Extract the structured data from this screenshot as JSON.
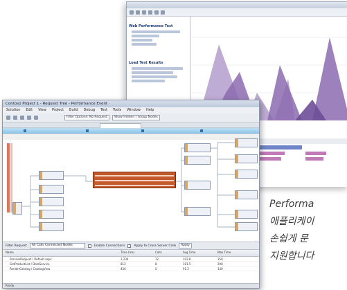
{
  "back_window": {
    "side_group_1": "Web Performance Test",
    "side_group_2": "Load Test Results"
  },
  "front_window": {
    "title": "Contoso Project 1 - Request Tree - Performance Event",
    "menu": [
      "Solution",
      "Edit",
      "View",
      "Project",
      "Build",
      "Debug",
      "Test",
      "Tools",
      "Window",
      "Help"
    ],
    "toolbar_dropdown": "Filter Options: No Request",
    "toolbar_button": "Show Hidden / Group Nodes",
    "filter_label": "Filter Request",
    "filter_value": "All Calls Connected Nodes",
    "filter_option_1": "Enable Connections",
    "filter_option_2": "Apply to Cross Server Calls",
    "filter_button": "Apply",
    "grid_headers": [
      "Name",
      "Time (ms)",
      "Calls",
      "Avg Time",
      "Max Time"
    ],
    "grid_rows": [
      [
        "ProcessRequest / Default.aspx",
        "1,234",
        "12",
        "102.8",
        "350"
      ],
      [
        "GetProductList / DataService",
        "812",
        "8",
        "101.5",
        "290"
      ],
      [
        "RenderCatalog / CatalogView",
        "456",
        "5",
        "91.2",
        "140"
      ]
    ],
    "status": "Ready"
  },
  "caption": {
    "line1": "Performa",
    "line2": "애플리케이",
    "line3": "손쉽게 문",
    "line4": "지원합니다"
  }
}
